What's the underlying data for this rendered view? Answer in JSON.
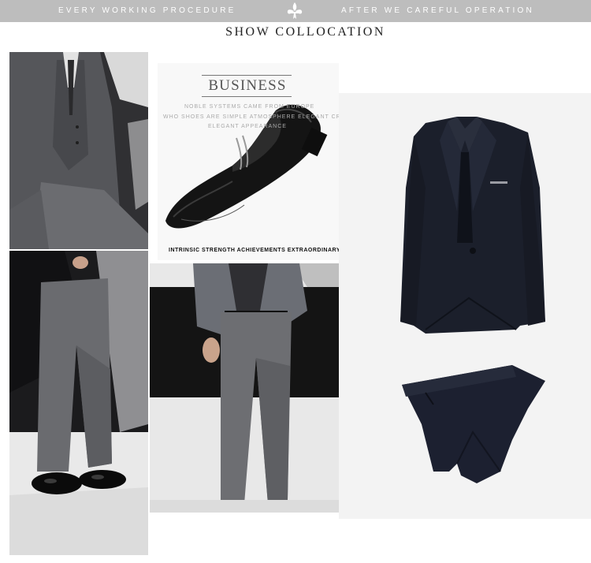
{
  "banner": {
    "left_text": "EVERY WORKING PROCEDURE",
    "right_text": "AFTER WE CAREFUL OPERATION"
  },
  "section_title": "SHOW COLLOCATION",
  "business_card": {
    "title": "BUSINESS",
    "line1": "NOBLE SYSTEMS CAME FROM EUROPE",
    "line2": "WHO SHOES ARE SIMPLE ATMOSPHERE ELEGANT CREATING",
    "line3": "ELEGANT APPEARANCE",
    "tagline": "INTRINSIC STRENGTH ACHIEVEMENTS EXTRAORDINARY"
  },
  "icons": {
    "banner_emblem": "fleur-de-lis-icon"
  },
  "colors": {
    "banner": "#bdbdbd",
    "suit_navy": "#1b1f2b",
    "trouser_gray": "#5f6064"
  }
}
